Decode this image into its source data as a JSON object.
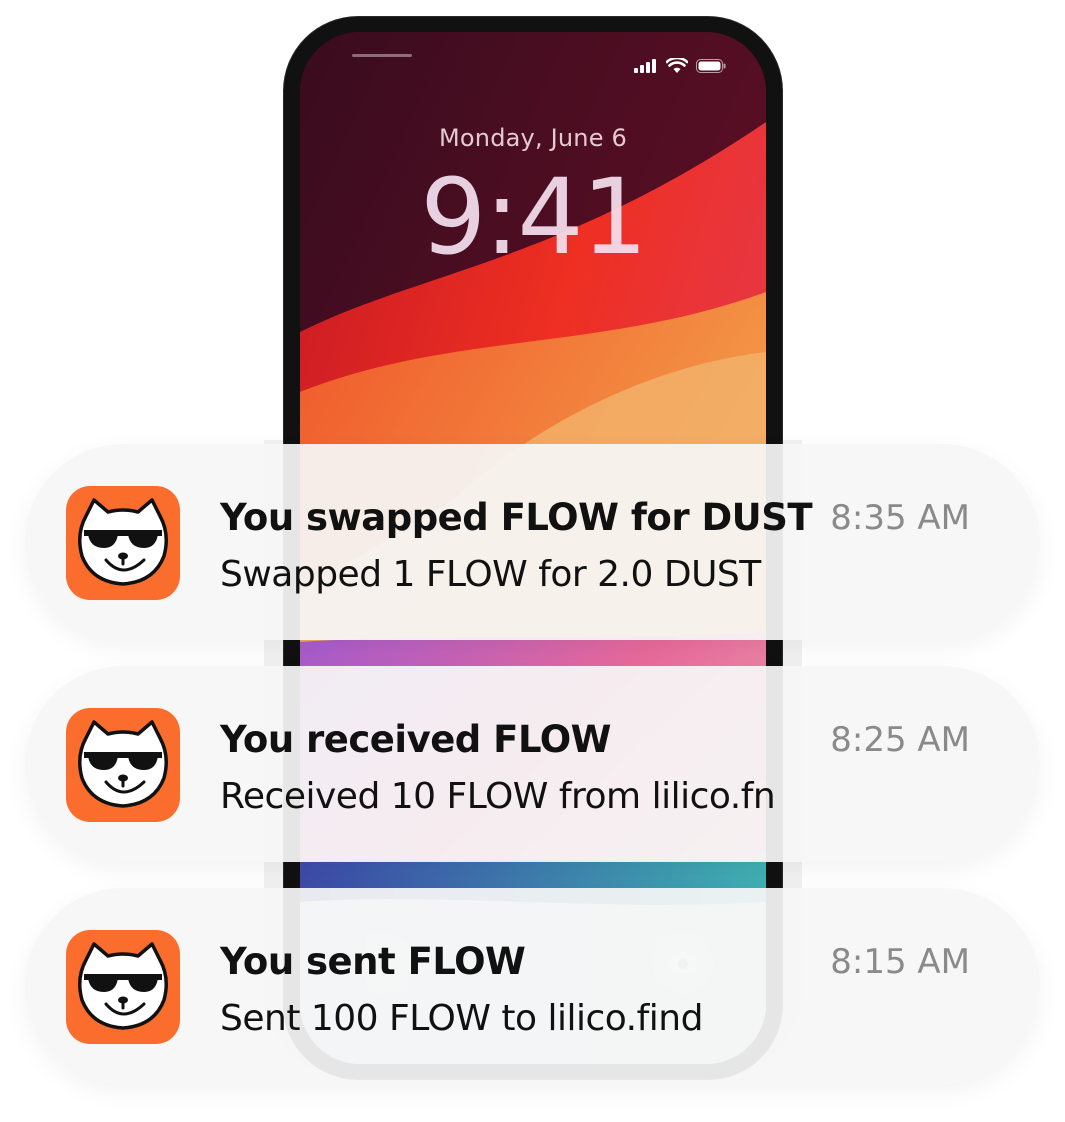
{
  "lock_screen": {
    "date": "Monday, June 6",
    "time": "9:41"
  },
  "status_bar": {
    "icons": [
      "cellular-signal-icon",
      "wifi-icon",
      "battery-icon"
    ]
  },
  "notifications": [
    {
      "app_icon": "lilico-cat-icon",
      "title": "You swapped FLOW for DUST",
      "body": "Swapped 1 FLOW for 2.0 DUST",
      "time": "8:35 AM"
    },
    {
      "app_icon": "lilico-cat-icon",
      "title": "You received FLOW",
      "body": "Received 10 FLOW from lilico.fn",
      "time": "8:25 AM"
    },
    {
      "app_icon": "lilico-cat-icon",
      "title": "You sent FLOW",
      "body": "Sent 100 FLOW to lilico.find",
      "time": "8:15 AM"
    }
  ],
  "colors": {
    "app_icon_bg": "#fb6d2c",
    "notification_bg": "#f6f6f6",
    "time_text": "#8a8a8a"
  }
}
